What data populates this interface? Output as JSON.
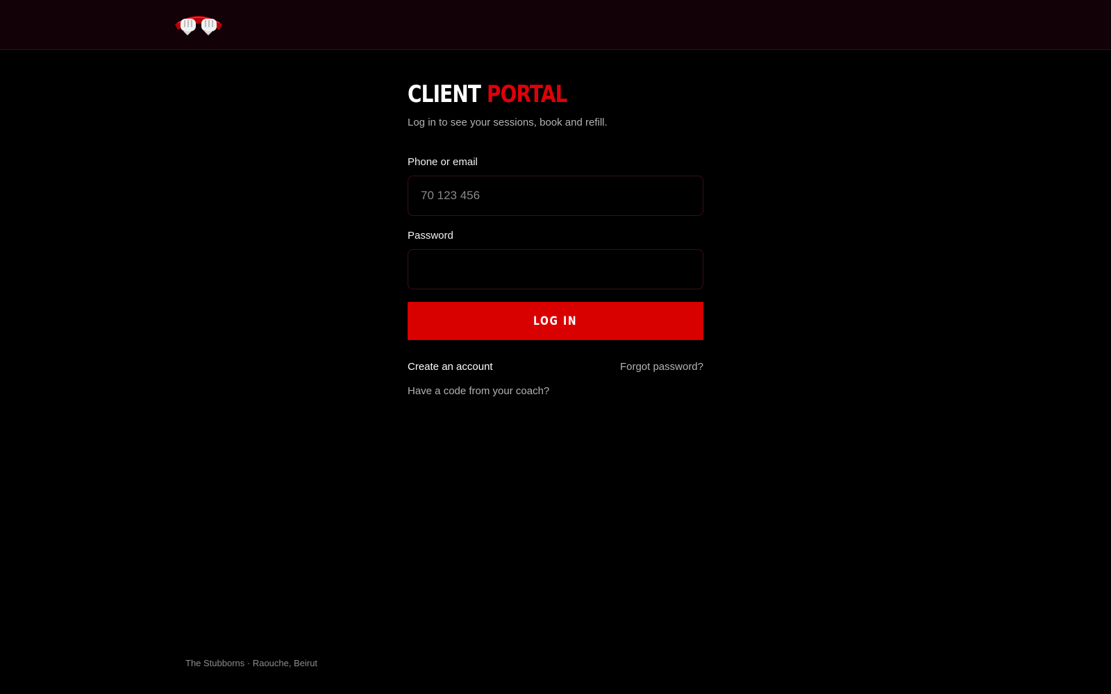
{
  "header": {
    "logo_icon": "fists-logo-icon"
  },
  "portal": {
    "title_part1": "CLIENT",
    "title_part2": "PORTAL",
    "subtitle": "Log in to see your sessions, book and refill."
  },
  "form": {
    "phone_label": "Phone or email",
    "phone_placeholder": "70 123 456",
    "phone_value": "",
    "password_label": "Password",
    "password_value": "",
    "login_label": "LOG IN"
  },
  "links": {
    "create_account": "Create an account",
    "forgot_password": "Forgot password?",
    "coach_code": "Have a code from your coach?"
  },
  "footer": {
    "text": "The Stubborns · Raouche, Beirut"
  },
  "colors": {
    "accent": "#d90000",
    "header_bg": "#120106",
    "background": "#000000",
    "input_border": "#3a1018"
  }
}
